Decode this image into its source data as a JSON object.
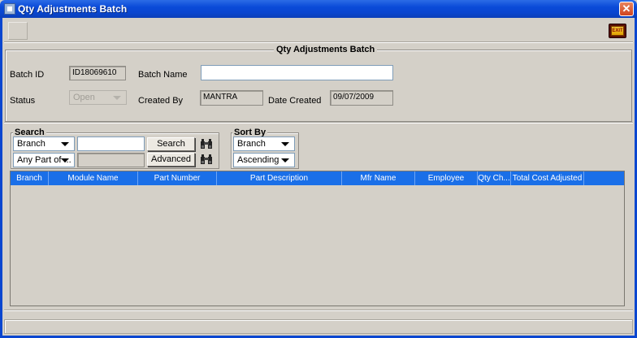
{
  "window": {
    "title": "Qty Adjustments Batch",
    "close_icon": "close-icon"
  },
  "toolbar": {
    "exit_label": "EXIT"
  },
  "panel": {
    "title": "Qty Adjustments Batch",
    "batch_id_label": "Batch ID",
    "batch_id_value": "ID18069610",
    "batch_name_label": "Batch Name",
    "batch_name_value": "",
    "status_label": "Status",
    "status_value": "Open",
    "created_by_label": "Created By",
    "created_by_value": "MANTRA",
    "date_created_label": "Date Created",
    "date_created_value": "09/07/2009"
  },
  "search": {
    "title": "Search",
    "field_select": "Branch",
    "match_select": "Any Part of ...",
    "text_value": "",
    "search_button": "Search",
    "advanced_button": "Advanced"
  },
  "sort": {
    "title": "Sort By",
    "field_select": "Branch",
    "order_select": "Ascending"
  },
  "table": {
    "columns": [
      "Branch",
      "Module Name",
      "Part Number",
      "Part Description",
      "Mfr Name",
      "Employee",
      "Qty Ch...",
      "Total Cost Adjusted"
    ]
  },
  "colors": {
    "accent": "#1a6fe8",
    "titlebar": "#0a46d0",
    "background": "#d4d0c8"
  }
}
